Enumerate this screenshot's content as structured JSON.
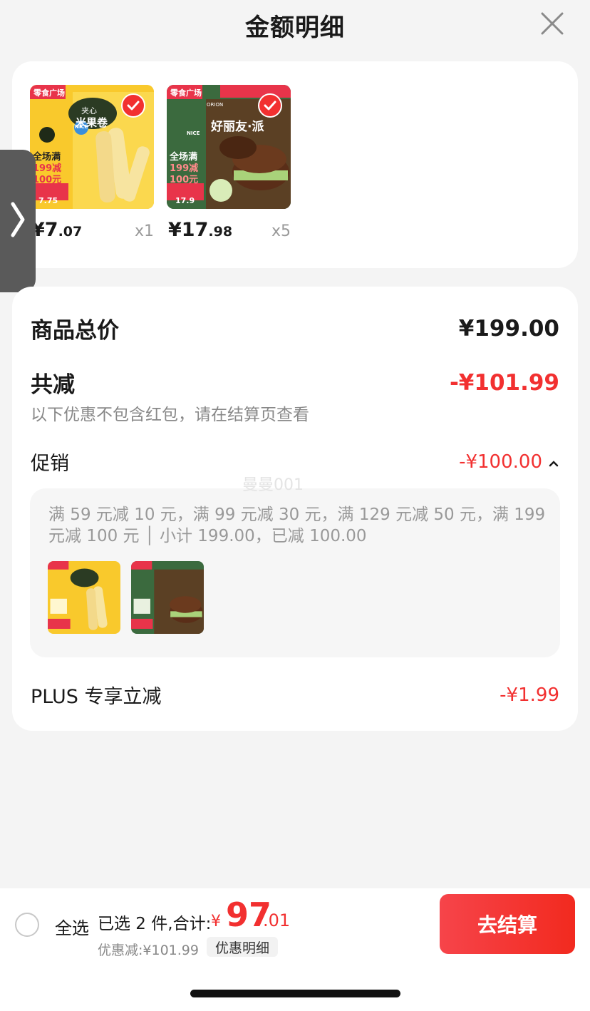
{
  "header": {
    "title": "金额明细"
  },
  "products": [
    {
      "price_int": "¥7",
      "price_dec": ".07",
      "qty": "x1",
      "thumb": {
        "tag": "零食广场",
        "brand": "夹心",
        "name": "米果卷",
        "nice": "NICE",
        "promo_line1": "全场满",
        "promo_line2": "199减",
        "promo_line3": "100元",
        "price_tag": "7.75"
      }
    },
    {
      "price_int": "¥17",
      "price_dec": ".98",
      "qty": "x5",
      "thumb": {
        "tag": "零食广场",
        "brand": "ORION",
        "name": "好丽友·派",
        "nice": "NICE",
        "promo_line1": "全场满",
        "promo_line2": "199减",
        "promo_line3": "100元",
        "price_tag": "17.9"
      }
    }
  ],
  "summary": {
    "total_label": "商品总价",
    "total_value": "¥199.00",
    "discount_label": "共减",
    "discount_value": "-¥101.99",
    "discount_note": "以下优惠不包含红包，请在结算页查看",
    "promo_label": "促销",
    "promo_value": "-¥100.00",
    "promo_detail": "满 59 元减 10 元，满 99 元减 30 元，满 129 元减 50 元，满 199 元减 100 元 │ 小计 199.00，已减 100.00",
    "plus_label": "PLUS 专享立减",
    "plus_value": "-¥1.99"
  },
  "watermark": "曼曼001",
  "bottom": {
    "select_all": "全选",
    "selected_info": "已选 2 件,合计:",
    "total_yen": "¥",
    "total_int": "97",
    "total_dec": ".01",
    "saved": "优惠减:¥101.99",
    "detail_chip": "优惠明细",
    "checkout": "去结算"
  },
  "colors": {
    "accent": "#f23030",
    "background": "#f4f4f4"
  },
  "icons": {
    "close": "close-icon",
    "check": "check-icon",
    "side": "chevron-right-icon",
    "expand": "chevron-up-icon"
  }
}
